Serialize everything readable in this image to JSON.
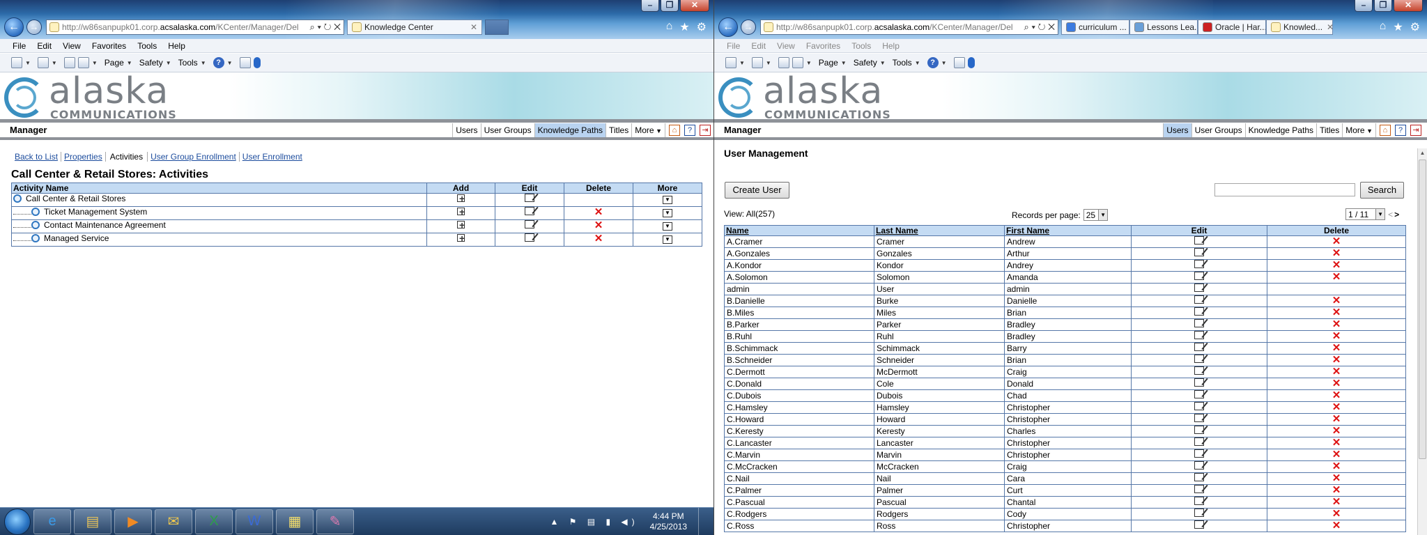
{
  "left": {
    "address": {
      "pre": "http://w86sanpupk01.corp.",
      "host": "acsalaska.com",
      "post": "/KCenter/Manager/Del"
    },
    "tab_label": "Knowledge Center",
    "menu": [
      "File",
      "Edit",
      "View",
      "Favorites",
      "Tools",
      "Help"
    ],
    "cmd": {
      "page": "Page",
      "safety": "Safety",
      "tools": "Tools"
    },
    "logo": {
      "word": "alaska",
      "sub": "COMMUNICATIONS"
    },
    "manager_title": "Manager",
    "nav": [
      "Users",
      "User Groups",
      "Knowledge Paths",
      "Titles",
      "More"
    ],
    "nav_active": "Knowledge Paths",
    "sublinks": {
      "back": "Back to List",
      "props": "Properties",
      "activities": "Activities",
      "group_enroll": "User Group Enrollment",
      "user_enroll": "User Enrollment"
    },
    "page_title": "Call Center & Retail Stores: Activities",
    "table": {
      "headers": [
        "Activity Name",
        "Add",
        "Edit",
        "Delete",
        "More"
      ],
      "rows": [
        {
          "name": "Call Center & Retail Stores",
          "delete": false,
          "child": false
        },
        {
          "name": "Ticket Management System",
          "delete": true,
          "child": true
        },
        {
          "name": "Contact Maintenance Agreement",
          "delete": true,
          "child": true
        },
        {
          "name": "Managed Service",
          "delete": true,
          "child": true
        }
      ]
    },
    "taskbar": {
      "time": "4:44 PM",
      "date": "4/25/2013"
    }
  },
  "right": {
    "address": {
      "pre": "http://w86sanpupk01.corp.",
      "host": "acsalaska.com",
      "post": "/KCenter/Manager/Del"
    },
    "tabs": [
      "curriculum ...",
      "Lessons Lea...",
      "Oracle | Har...",
      "Knowled..."
    ],
    "tab_colors": [
      "#3b7be0",
      "#6aa0d8",
      "#cc2222",
      "#d9c35a"
    ],
    "menu": [
      "File",
      "Edit",
      "View",
      "Favorites",
      "Tools",
      "Help"
    ],
    "manager_title": "Manager",
    "nav": [
      "Users",
      "User Groups",
      "Knowledge Paths",
      "Titles",
      "More"
    ],
    "nav_active": "Users",
    "page_title": "User Management",
    "create_button": "Create User",
    "search_button": "Search",
    "search_value": "",
    "view_all": "View: All(257)",
    "records_label": "Records per page:",
    "records_value": "25",
    "pager_value": "1 / 11",
    "pager_prev": "<",
    "pager_next": ">",
    "table": {
      "headers": [
        "Name",
        "Last Name",
        "First Name",
        "Edit",
        "Delete"
      ],
      "rows": [
        [
          "A.Cramer",
          "Cramer",
          "Andrew",
          1
        ],
        [
          "A.Gonzales",
          "Gonzales",
          "Arthur",
          1
        ],
        [
          "A.Kondor",
          "Kondor",
          "Andrey",
          1
        ],
        [
          "A.Solomon",
          "Solomon",
          "Amanda",
          1
        ],
        [
          "admin",
          "User",
          "admin",
          0
        ],
        [
          "B.Danielle",
          "Burke",
          "Danielle",
          1
        ],
        [
          "B.Miles",
          "Miles",
          "Brian",
          1
        ],
        [
          "B.Parker",
          "Parker",
          "Bradley",
          1
        ],
        [
          "B.Ruhl",
          "Ruhl",
          "Bradley",
          1
        ],
        [
          "B.Schimmack",
          "Schimmack",
          "Barry",
          1
        ],
        [
          "B.Schneider",
          "Schneider",
          "Brian",
          1
        ],
        [
          "C.Dermott",
          "McDermott",
          "Craig",
          1
        ],
        [
          "C.Donald",
          "Cole",
          "Donald",
          1
        ],
        [
          "C.Dubois",
          "Dubois",
          "Chad",
          1
        ],
        [
          "C.Hamsley",
          "Hamsley",
          "Christopher",
          1
        ],
        [
          "C.Howard",
          "Howard",
          "Christopher",
          1
        ],
        [
          "C.Keresty",
          "Keresty",
          "Charles",
          1
        ],
        [
          "C.Lancaster",
          "Lancaster",
          "Christopher",
          1
        ],
        [
          "C.Marvin",
          "Marvin",
          "Christopher",
          1
        ],
        [
          "C.McCracken",
          "McCracken",
          "Craig",
          1
        ],
        [
          "C.Nail",
          "Nail",
          "Cara",
          1
        ],
        [
          "C.Palmer",
          "Palmer",
          "Curt",
          1
        ],
        [
          "C.Pascual",
          "Pascual",
          "Chantal",
          1
        ],
        [
          "C.Rodgers",
          "Rodgers",
          "Cody",
          1
        ],
        [
          "C.Ross",
          "Ross",
          "Christopher",
          1
        ]
      ]
    }
  }
}
